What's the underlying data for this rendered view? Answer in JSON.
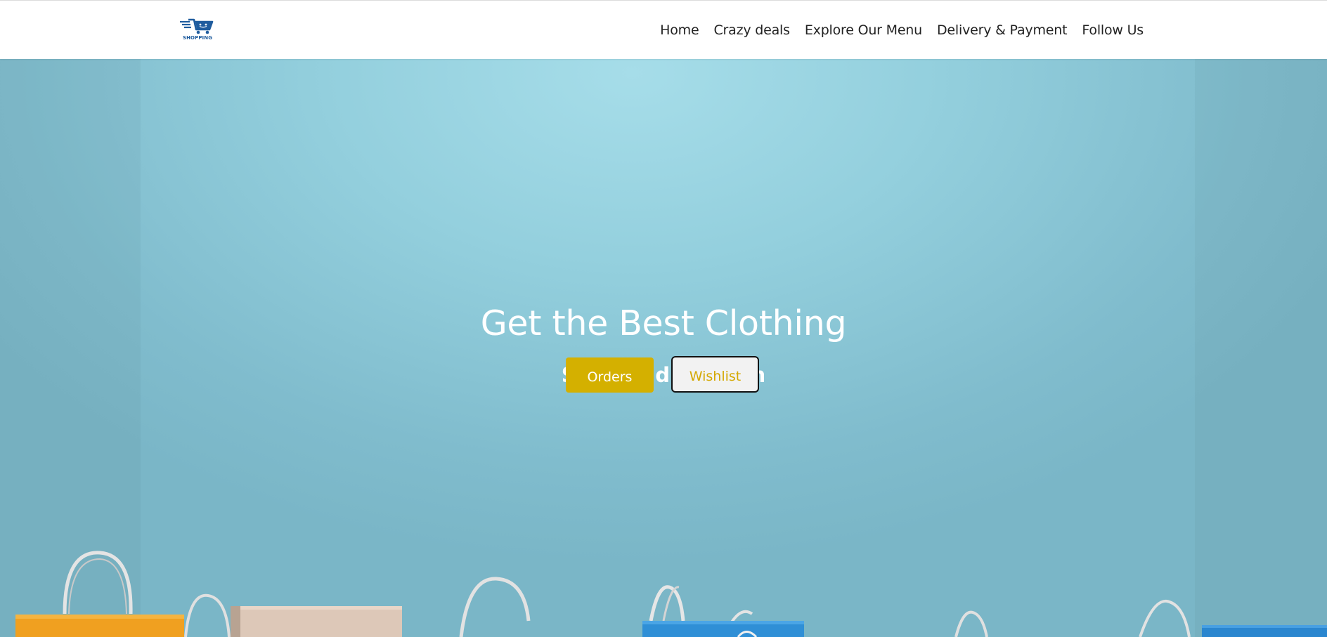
{
  "brand": {
    "logo_text": "SHOPPING",
    "logo_color": "#1f5c9e"
  },
  "nav": {
    "items": [
      {
        "label": "Home"
      },
      {
        "label": "Crazy deals"
      },
      {
        "label": "Explore Our Menu"
      },
      {
        "label": "Delivery & Payment"
      },
      {
        "label": "Follow Us"
      }
    ]
  },
  "hero": {
    "title": "Get the Best Clothing",
    "subtitle": "Style and Fashion",
    "background_color": "#8fcad9",
    "buttons": {
      "orders_label": "Orders",
      "wishlist_label": "Wishlist",
      "accent_color": "#d4b000"
    }
  }
}
